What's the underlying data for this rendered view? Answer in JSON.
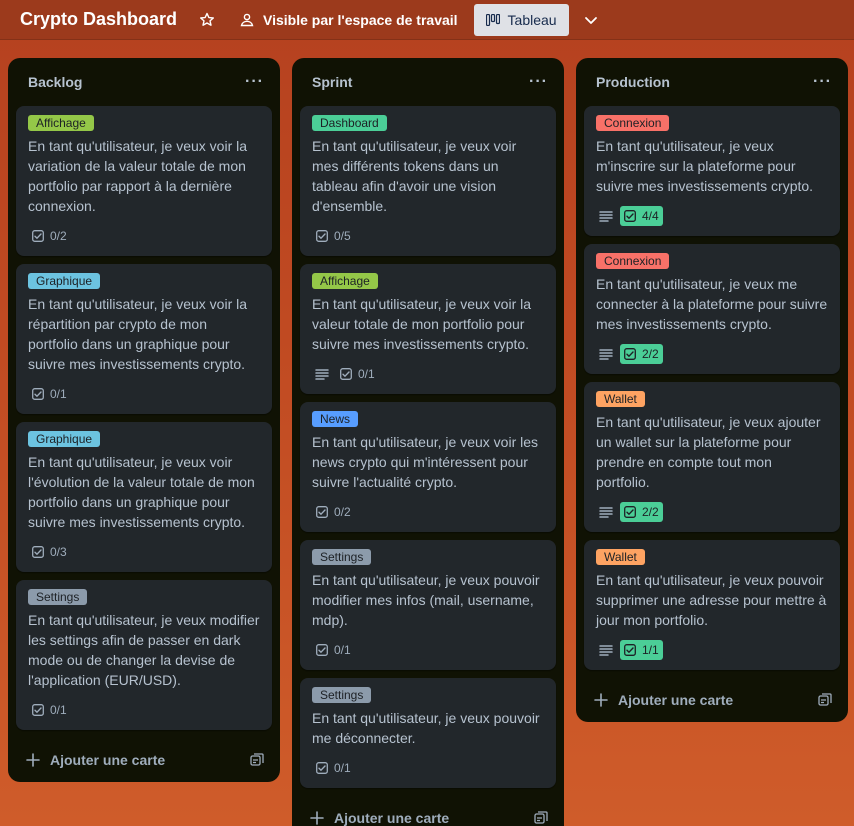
{
  "header": {
    "title": "Crypto Dashboard",
    "visibility": "Visible par l'espace de travail",
    "view": "Tableau"
  },
  "add_card_label": "Ajouter une carte",
  "lists": [
    {
      "title": "Backlog",
      "cards": [
        {
          "label": "Affichage",
          "label_color": "#94c748",
          "text": "En tant qu'utilisateur, je veux voir la variation de la valeur totale de mon portfolio par rapport à la dernière connexion.",
          "checklist": "0/2",
          "complete": false,
          "description": false
        },
        {
          "label": "Graphique",
          "label_color": "#6cc3e0",
          "text": "En tant qu'utilisateur, je veux voir la répartition par crypto de mon portfolio dans un graphique pour suivre mes investissements crypto.",
          "checklist": "0/1",
          "complete": false,
          "description": false
        },
        {
          "label": "Graphique",
          "label_color": "#6cc3e0",
          "text": "En tant qu'utilisateur, je veux voir l'évolution de la valeur totale de mon portfolio dans un graphique pour suivre mes investissements crypto.",
          "checklist": "0/3",
          "complete": false,
          "description": false
        },
        {
          "label": "Settings",
          "label_color": "#8c9bab",
          "text": "En tant qu'utilisateur, je veux modifier les settings afin de passer en dark mode ou de changer la devise de l'application (EUR/USD).",
          "checklist": "0/1",
          "complete": false,
          "description": false
        }
      ]
    },
    {
      "title": "Sprint",
      "cards": [
        {
          "label": "Dashboard",
          "label_color": "#4bce97",
          "text": "En tant qu'utilisateur, je veux voir mes différents tokens dans un tableau afin d'avoir une vision d'ensemble.",
          "checklist": "0/5",
          "complete": false,
          "description": false
        },
        {
          "label": "Affichage",
          "label_color": "#94c748",
          "text": "En tant qu'utilisateur, je veux voir la valeur totale de mon portfolio pour suivre mes investissements crypto.",
          "checklist": "0/1",
          "complete": false,
          "description": true
        },
        {
          "label": "News",
          "label_color": "#579dff",
          "text": "En tant qu'utilisateur, je veux voir les news crypto qui m'intéressent pour suivre l'actualité crypto.",
          "checklist": "0/2",
          "complete": false,
          "description": false
        },
        {
          "label": "Settings",
          "label_color": "#8c9bab",
          "text": "En tant qu'utilisateur, je veux pouvoir modifier mes infos (mail, username, mdp).",
          "checklist": "0/1",
          "complete": false,
          "description": false
        },
        {
          "label": "Settings",
          "label_color": "#8c9bab",
          "text": "En tant qu'utilisateur, je veux pouvoir me déconnecter.",
          "checklist": "0/1",
          "complete": false,
          "description": false
        }
      ]
    },
    {
      "title": "Production",
      "cards": [
        {
          "label": "Connexion",
          "label_color": "#f87168",
          "text": "En tant qu'utilisateur, je veux m'inscrire sur la plateforme pour suivre mes investissements crypto.",
          "checklist": "4/4",
          "complete": true,
          "description": true
        },
        {
          "label": "Connexion",
          "label_color": "#f87168",
          "text": "En tant qu'utilisateur, je veux me connecter à la plateforme pour suivre mes investissements crypto.",
          "checklist": "2/2",
          "complete": true,
          "description": true
        },
        {
          "label": "Wallet",
          "label_color": "#fea362",
          "text": "En tant qu'utilisateur, je veux ajouter un wallet sur la plateforme pour prendre en compte tout mon portfolio.",
          "checklist": "2/2",
          "complete": true,
          "description": true
        },
        {
          "label": "Wallet",
          "label_color": "#fea362",
          "text": "En tant qu'utilisateur, je veux pouvoir supprimer une adresse pour mettre à jour mon portfolio.",
          "checklist": "1/1",
          "complete": true,
          "description": true
        }
      ]
    }
  ]
}
